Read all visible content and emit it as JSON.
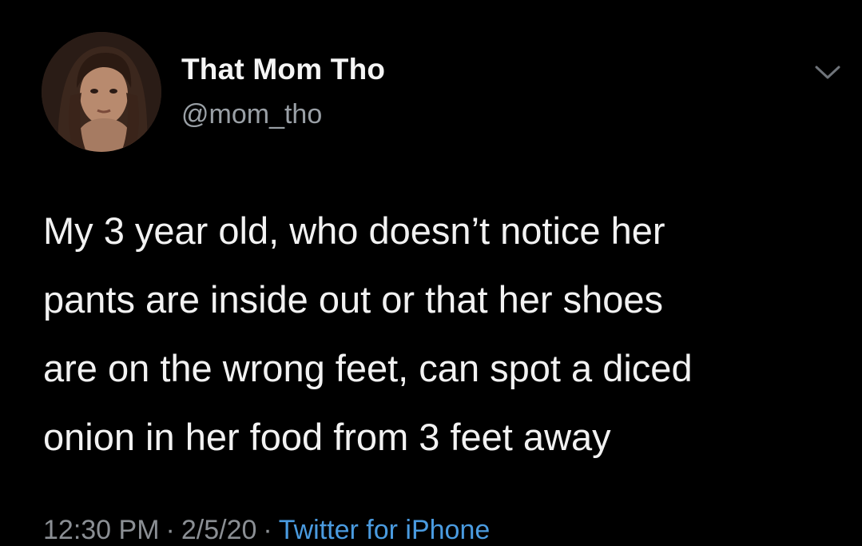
{
  "user": {
    "display_name": "That Mom Tho",
    "handle": "@mom_tho"
  },
  "menu": {
    "icon": "chevron-down-icon"
  },
  "tweet": {
    "lines": [
      "My 3 year old, who doesn’t notice her",
      "pants are inside out or that her shoes",
      "are on the wrong feet, can spot a diced",
      "onion in her food from 3 feet away"
    ]
  },
  "meta": {
    "time": "12:30 PM",
    "date": "2/5/20",
    "separator": "·",
    "source": "Twitter for iPhone"
  },
  "colors": {
    "background": "#000000",
    "text": "#f2f2f2",
    "secondary": "#9aa0a6",
    "link": "#4a9be0"
  }
}
